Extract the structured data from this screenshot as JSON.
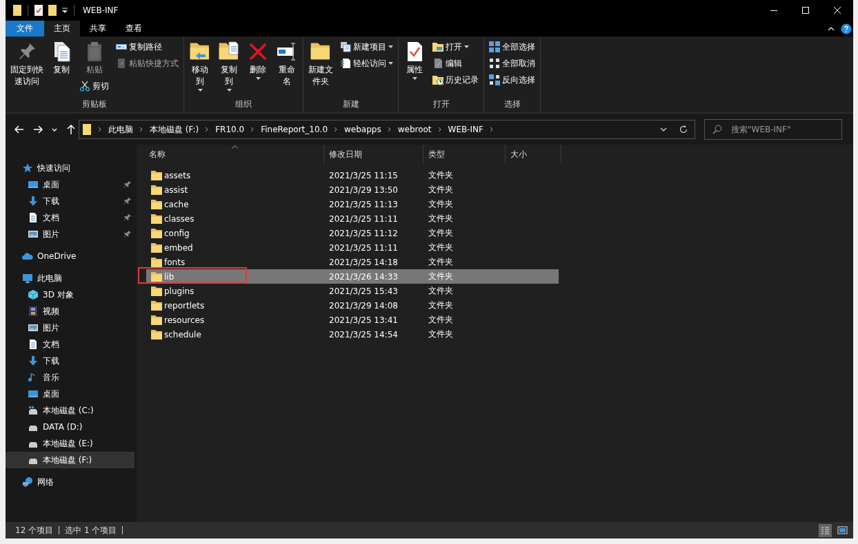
{
  "window": {
    "title": "WEB-INF"
  },
  "ribbon_tabs": [
    {
      "label": "文件",
      "kind": "file",
      "selected": false
    },
    {
      "label": "主页",
      "kind": "tab",
      "selected": true
    },
    {
      "label": "共享",
      "kind": "tab",
      "selected": false
    },
    {
      "label": "查看",
      "kind": "tab",
      "selected": false
    }
  ],
  "ribbon": {
    "groups": [
      {
        "label": "剪贴板",
        "columns": [
          {
            "buttons": [
              {
                "kind": "large",
                "label": "固定到快速访问",
                "disabled": false,
                "caret": false
              }
            ]
          },
          {
            "buttons": [
              {
                "kind": "large",
                "label": "复制",
                "disabled": false,
                "caret": false
              }
            ]
          },
          {
            "buttons": [
              {
                "kind": "large",
                "label": "粘贴",
                "disabled": true,
                "caret": false
              },
              {
                "kind": "small",
                "label": "剪切",
                "disabled": false,
                "caret": false
              }
            ]
          },
          {
            "buttons": [
              {
                "kind": "small",
                "label": "复制路径",
                "disabled": false,
                "caret": false
              },
              {
                "kind": "small",
                "label": "粘贴快捷方式",
                "disabled": true,
                "caret": false
              }
            ]
          }
        ]
      },
      {
        "label": "组织",
        "columns": [
          {
            "buttons": [
              {
                "kind": "large",
                "label": "移动到",
                "disabled": false,
                "caret": true
              }
            ]
          },
          {
            "buttons": [
              {
                "kind": "large",
                "label": "复制到",
                "disabled": false,
                "caret": true
              }
            ]
          },
          {
            "buttons": [
              {
                "kind": "large",
                "label": "删除",
                "disabled": false,
                "caret": true
              }
            ]
          },
          {
            "buttons": [
              {
                "kind": "large",
                "label": "重命名",
                "disabled": false,
                "caret": false
              }
            ]
          }
        ]
      },
      {
        "label": "新建",
        "columns": [
          {
            "buttons": [
              {
                "kind": "large",
                "label": "新建文件夹",
                "disabled": false,
                "caret": false
              }
            ]
          },
          {
            "buttons": [
              {
                "kind": "small",
                "label": "新建项目",
                "disabled": false,
                "caret": true
              },
              {
                "kind": "small",
                "label": "轻松访问",
                "disabled": false,
                "caret": true
              }
            ]
          }
        ]
      },
      {
        "label": "打开",
        "columns": [
          {
            "buttons": [
              {
                "kind": "large",
                "label": "属性",
                "disabled": false,
                "caret": true
              }
            ]
          },
          {
            "buttons": [
              {
                "kind": "small",
                "label": "打开",
                "disabled": false,
                "caret": true
              },
              {
                "kind": "small",
                "label": "编辑",
                "disabled": false,
                "caret": false
              },
              {
                "kind": "small",
                "label": "历史记录",
                "disabled": false,
                "caret": false
              }
            ]
          }
        ]
      },
      {
        "label": "选择",
        "columns": [
          {
            "buttons": [
              {
                "kind": "small",
                "label": "全部选择",
                "disabled": false,
                "caret": false
              },
              {
                "kind": "small",
                "label": "全部取消",
                "disabled": false,
                "caret": false
              },
              {
                "kind": "small",
                "label": "反向选择",
                "disabled": false,
                "caret": false
              }
            ]
          }
        ]
      }
    ]
  },
  "address_bar": {
    "path": [
      "此电脑",
      "本地磁盘 (F:)",
      "FR10.0",
      "FineReport_10.0",
      "webapps",
      "webroot",
      "WEB-INF"
    ]
  },
  "search": {
    "placeholder": "搜索\"WEB-INF\""
  },
  "sidebar": {
    "items": [
      {
        "label": "快速访问",
        "selected": false,
        "pinned": false,
        "children": [
          {
            "label": "桌面",
            "selected": false,
            "pinned": true
          },
          {
            "label": "下载",
            "selected": false,
            "pinned": true
          },
          {
            "label": "文档",
            "selected": false,
            "pinned": true
          },
          {
            "label": "图片",
            "selected": false,
            "pinned": true
          }
        ]
      },
      {
        "label": "OneDrive",
        "selected": false,
        "pinned": false
      },
      {
        "label": "此电脑",
        "selected": false,
        "pinned": false,
        "children": [
          {
            "label": "3D 对象",
            "selected": false,
            "pinned": false
          },
          {
            "label": "视频",
            "selected": false,
            "pinned": false
          },
          {
            "label": "图片",
            "selected": false,
            "pinned": false
          },
          {
            "label": "文档",
            "selected": false,
            "pinned": false
          },
          {
            "label": "下载",
            "selected": false,
            "pinned": false
          },
          {
            "label": "音乐",
            "selected": false,
            "pinned": false
          },
          {
            "label": "桌面",
            "selected": false,
            "pinned": false
          },
          {
            "label": "本地磁盘 (C:)",
            "selected": false,
            "pinned": false
          },
          {
            "label": "DATA (D:)",
            "selected": false,
            "pinned": false
          },
          {
            "label": "本地磁盘 (E:)",
            "selected": false,
            "pinned": false
          },
          {
            "label": "本地磁盘 (F:)",
            "selected": true,
            "pinned": false
          }
        ]
      },
      {
        "label": "网络",
        "selected": false,
        "pinned": false
      }
    ]
  },
  "table": {
    "columns": [
      {
        "label": "名称",
        "sorted": true
      },
      {
        "label": "修改日期",
        "sorted": false
      },
      {
        "label": "类型",
        "sorted": false
      },
      {
        "label": "大小",
        "sorted": false
      }
    ],
    "rows": [
      {
        "name": "assets",
        "date": "2021/3/25 11:15",
        "type": "文件夹",
        "selected": false,
        "annotated": false
      },
      {
        "name": "assist",
        "date": "2021/3/29 13:50",
        "type": "文件夹",
        "selected": false,
        "annotated": false
      },
      {
        "name": "cache",
        "date": "2021/3/25 11:13",
        "type": "文件夹",
        "selected": false,
        "annotated": false
      },
      {
        "name": "classes",
        "date": "2021/3/25 11:11",
        "type": "文件夹",
        "selected": false,
        "annotated": false
      },
      {
        "name": "config",
        "date": "2021/3/25 11:12",
        "type": "文件夹",
        "selected": false,
        "annotated": false
      },
      {
        "name": "embed",
        "date": "2021/3/25 11:11",
        "type": "文件夹",
        "selected": false,
        "annotated": false
      },
      {
        "name": "fonts",
        "date": "2021/3/25 14:18",
        "type": "文件夹",
        "selected": false,
        "annotated": false
      },
      {
        "name": "lib",
        "date": "2021/3/26 14:33",
        "type": "文件夹",
        "selected": true,
        "annotated": true
      },
      {
        "name": "plugins",
        "date": "2021/3/25 15:43",
        "type": "文件夹",
        "selected": false,
        "annotated": false
      },
      {
        "name": "reportlets",
        "date": "2021/3/29 14:08",
        "type": "文件夹",
        "selected": false,
        "annotated": false
      },
      {
        "name": "resources",
        "date": "2021/3/25 13:41",
        "type": "文件夹",
        "selected": false,
        "annotated": false
      },
      {
        "name": "schedule",
        "date": "2021/3/25 14:54",
        "type": "文件夹",
        "selected": false,
        "annotated": false
      }
    ]
  },
  "status_bar": {
    "items": [
      "12 个项目",
      "选中 1 个项目"
    ],
    "views": [
      {
        "selected": true
      },
      {
        "selected": false
      }
    ]
  }
}
